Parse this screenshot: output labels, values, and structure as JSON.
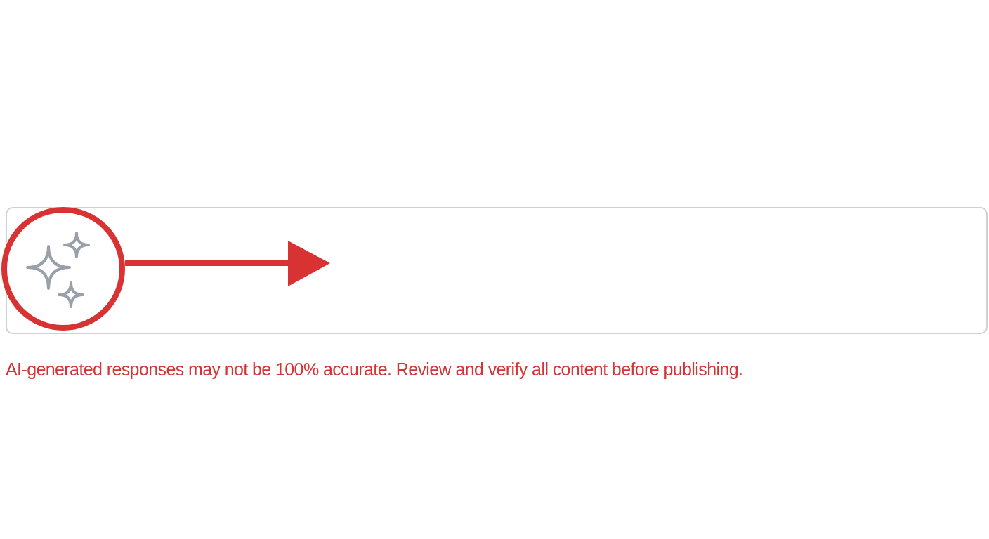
{
  "disclaimer": "AI-generated responses may not be 100% accurate. Review and verify all content before publishing."
}
